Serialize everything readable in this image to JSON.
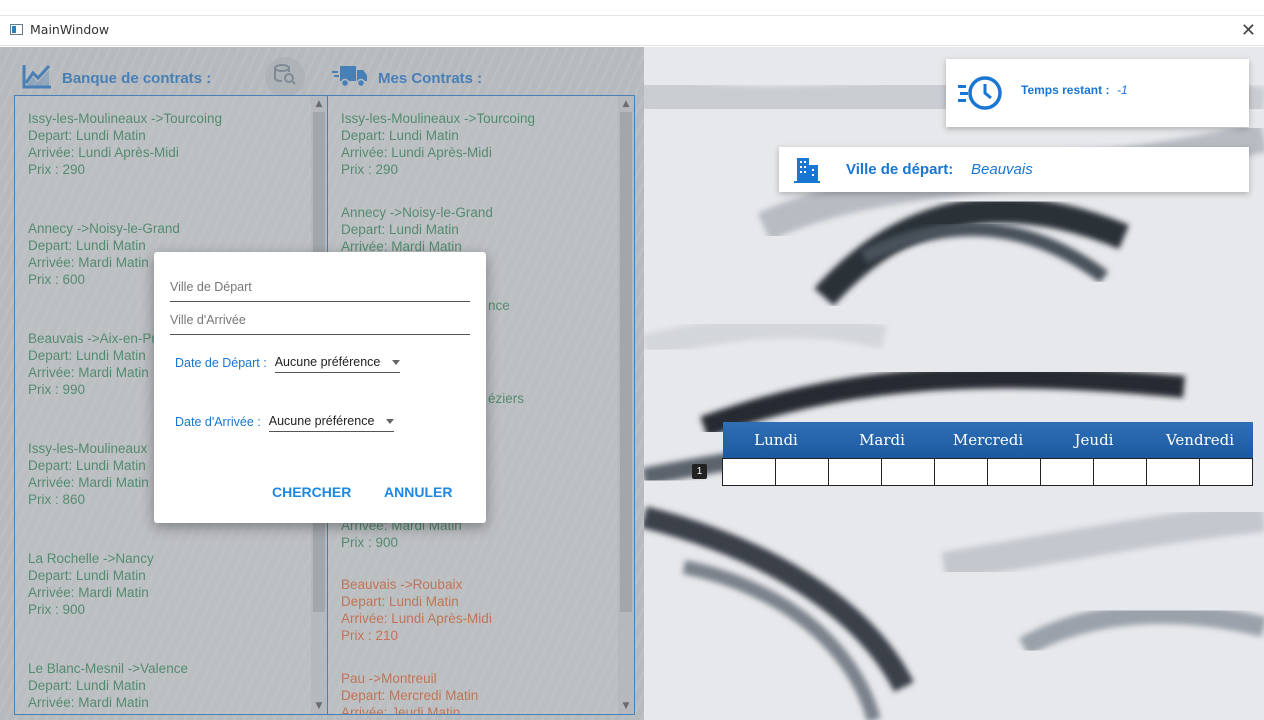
{
  "window": {
    "title": "MainWindow",
    "close_glyph": "✕"
  },
  "left_panel": {
    "bank_title": "Banque de contrats :",
    "my_title": "Mes Contrats :",
    "bank_items": [
      {
        "route": "Issy-les-Moulineaux ->Tourcoing",
        "depart": "Depart: Lundi Matin",
        "arrivee": "Arrivée: Lundi Après-Midi",
        "prix": "Prix : 290"
      },
      {
        "route": "Annecy ->Noisy-le-Grand",
        "depart": "Depart: Lundi Matin",
        "arrivee": "Arrivée: Mardi Matin",
        "prix": "Prix : 600"
      },
      {
        "route": "Beauvais ->Aix-en-Pr",
        "depart": "Depart: Lundi Matin",
        "arrivee": "Arrivée: Mardi Matin",
        "prix": "Prix : 990"
      },
      {
        "route": "Issy-les-Moulineaux",
        "depart": "Depart: Lundi Matin",
        "arrivee": "Arrivée: Mardi Matin",
        "prix": "Prix : 860"
      },
      {
        "route": "La Rochelle ->Nancy",
        "depart": "Depart: Lundi Matin",
        "arrivee": "Arrivée: Mardi Matin",
        "prix": "Prix : 900"
      },
      {
        "route": "Le Blanc-Mesnil ->Valence",
        "depart": "Depart: Lundi Matin",
        "arrivee": "Arrivée: Mardi Matin",
        "prix": ""
      }
    ],
    "my_items": [
      {
        "route": "Issy-les-Moulineaux ->Tourcoing",
        "depart": "Depart: Lundi Matin",
        "arrivee": "Arrivée: Lundi Après-Midi",
        "prix": "Prix : 290"
      },
      {
        "route": "Annecy ->Noisy-le-Grand",
        "depart": "Depart: Lundi Matin",
        "arrivee": "Arrivée: Mardi Matin",
        "prix": ""
      },
      {
        "partial": "nce"
      },
      {
        "partial": "éziers"
      },
      {
        "route": "",
        "depart": "",
        "arrivee": "Arrivée: Mardi Matin",
        "prix": "Prix : 900"
      },
      {
        "route": "Beauvais ->Roubaix",
        "depart": "Depart: Lundi Matin",
        "arrivee": "Arrivée: Lundi Après-Midi",
        "prix": "Prix : 210"
      },
      {
        "route": "Pau ->Montreuil",
        "depart": "Depart: Mercredi Matin",
        "arrivee": "Arrivée: Jeudi Matin",
        "prix": ""
      }
    ]
  },
  "status": {
    "time_label": "Temps restant :",
    "time_value": "-1",
    "city_label": "Ville de départ:",
    "city_value": "Beauvais"
  },
  "planning": {
    "days": [
      "Lundi",
      "Mardi",
      "Mercredi",
      "Jeudi",
      "Vendredi"
    ],
    "row_number": "1"
  },
  "dialog": {
    "departure_city_placeholder": "Ville de Départ",
    "arrival_city_placeholder": "Ville d'Arrivée",
    "departure_date_label": "Date de Départ :",
    "departure_date_value": "Aucune préférence",
    "arrival_date_label": "Date d'Arrivée :",
    "arrival_date_value": "Aucune préférence",
    "search_button": "CHERCHER",
    "cancel_button": "ANNULER"
  },
  "colors": {
    "accent": "#1976d2",
    "bank_text": "#2e8b57",
    "warning_text": "#e8632a"
  }
}
